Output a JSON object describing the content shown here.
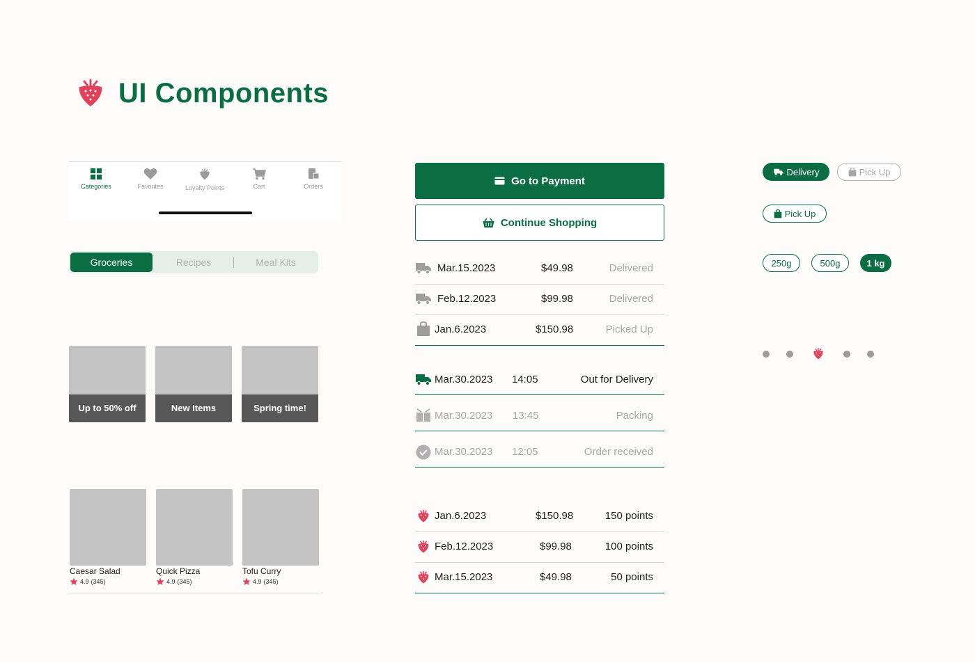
{
  "header": {
    "title": "UI Components"
  },
  "colors": {
    "brand_green": "#0b6e42",
    "strawberry_red": "#e3405a",
    "grey_placeholder": "#c4c4c4"
  },
  "tabbar": {
    "items": [
      {
        "label": "Categories",
        "icon": "grid-icon",
        "active": true
      },
      {
        "label": "Favorites",
        "icon": "heart-icon"
      },
      {
        "label": "Loyalty Points",
        "icon": "strawberry-icon"
      },
      {
        "label": "Cart",
        "icon": "cart-icon"
      },
      {
        "label": "Orders",
        "icon": "orders-icon"
      }
    ]
  },
  "segmented": {
    "items": [
      "Groceries",
      "Recipes",
      "Meal Kits"
    ],
    "selected": "Groceries"
  },
  "promos": [
    "Up to 50% off",
    "New Items",
    "Spring time!"
  ],
  "products": [
    {
      "name": "Caesar Salad",
      "rating": "4.9",
      "count": "(345)"
    },
    {
      "name": "Quick Pizza",
      "rating": "4.9",
      "count": "(345)"
    },
    {
      "name": "Tofu Curry",
      "rating": "4.9",
      "count": "(345)"
    }
  ],
  "buttons": {
    "payment": "Go to Payment",
    "continue": "Continue Shopping"
  },
  "orders": [
    {
      "date": "Mar.15.2023",
      "amount": "$49.98",
      "status": "Delivered",
      "icon": "truck-icon"
    },
    {
      "date": "Feb.12.2023",
      "amount": "$99.98",
      "status": "Delivered",
      "icon": "truck-icon"
    },
    {
      "date": "Jan.6.2023",
      "amount": "$150.98",
      "status": "Picked Up",
      "icon": "bag-icon"
    }
  ],
  "tracking": [
    {
      "date": "Mar.30.2023",
      "time": "14:05",
      "status": "Out for Delivery",
      "icon": "truck-icon",
      "active": true
    },
    {
      "date": "Mar.30.2023",
      "time": "13:45",
      "status": "Packing",
      "icon": "box-icon"
    },
    {
      "date": "Mar.30.2023",
      "time": "12:05",
      "status": "Order received",
      "icon": "check-circle-icon"
    }
  ],
  "points": [
    {
      "date": "Jan.6.2023",
      "amount": "$150.98",
      "points": "150 points"
    },
    {
      "date": "Feb.12.2023",
      "amount": "$99.98",
      "points": "100 points"
    },
    {
      "date": "Mar.15.2023",
      "amount": "$49.98",
      "points": "50 points"
    }
  ],
  "chips": {
    "delivery": "Delivery",
    "pickup_unselected": "Pick Up",
    "pickup_selected": "Pick Up",
    "weights": [
      "250g",
      "500g",
      "1 kg"
    ],
    "selected_weight": "1 kg"
  },
  "pager": {
    "count": 5,
    "active_index": 2
  }
}
